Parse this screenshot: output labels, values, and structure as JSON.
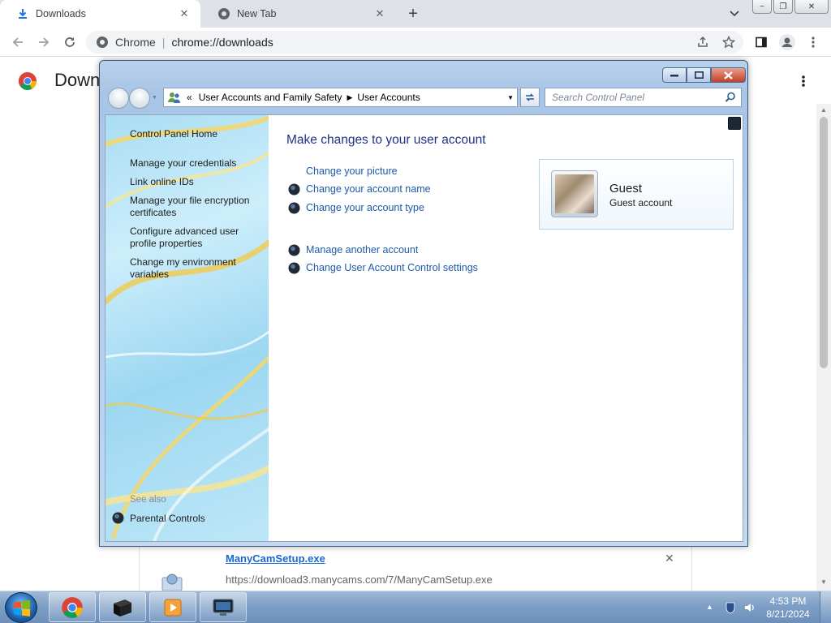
{
  "browser": {
    "tabs": [
      {
        "title": "Downloads",
        "active": true,
        "icon": "download-icon"
      },
      {
        "title": "New Tab",
        "active": false,
        "icon": "chrome-icon"
      }
    ],
    "close_glyph": "✕",
    "new_tab_glyph": "+",
    "window_controls": {
      "minimize": "−",
      "restore": "❐",
      "close": "✕"
    },
    "omnibox": {
      "site_name": "Chrome",
      "separator": "|",
      "url": "chrome://downloads"
    },
    "page_heading": "Down",
    "download": {
      "file_name": "ManyCamSetup.exe",
      "url": "https://download3.manycams.com/7/ManyCamSetup.exe"
    }
  },
  "control_panel": {
    "address": {
      "overflow": "«",
      "crumbs": [
        "User Accounts and Family Safety",
        "User Accounts"
      ]
    },
    "search": {
      "placeholder": "Search Control Panel"
    },
    "sidebar": {
      "home": "Control Panel Home",
      "links": [
        "Manage your credentials",
        "Link online IDs",
        "Manage your file encryption certificates",
        "Configure advanced user profile properties",
        "Change my environment variables"
      ],
      "see_also": "See also",
      "parental_controls": "Parental Controls"
    },
    "main": {
      "title": "Make changes to your user account",
      "tasks": [
        {
          "label": "Change your picture",
          "shield": false
        },
        {
          "label": "Change your account name",
          "shield": true
        },
        {
          "label": "Change your account type",
          "shield": true
        },
        {
          "label": "Manage another account",
          "shield": true
        },
        {
          "label": "Change User Account Control settings",
          "shield": true
        }
      ],
      "account": {
        "name": "Guest",
        "type": "Guest account"
      }
    }
  },
  "taskbar": {
    "clock": {
      "time": "4:53 PM",
      "date": "8/21/2024"
    }
  },
  "colors": {
    "chrome_tabstrip": "#dee1e6",
    "cp_link": "#1e5aa8",
    "cp_title": "#1e3287",
    "taskbar": "#7e9fc6"
  }
}
